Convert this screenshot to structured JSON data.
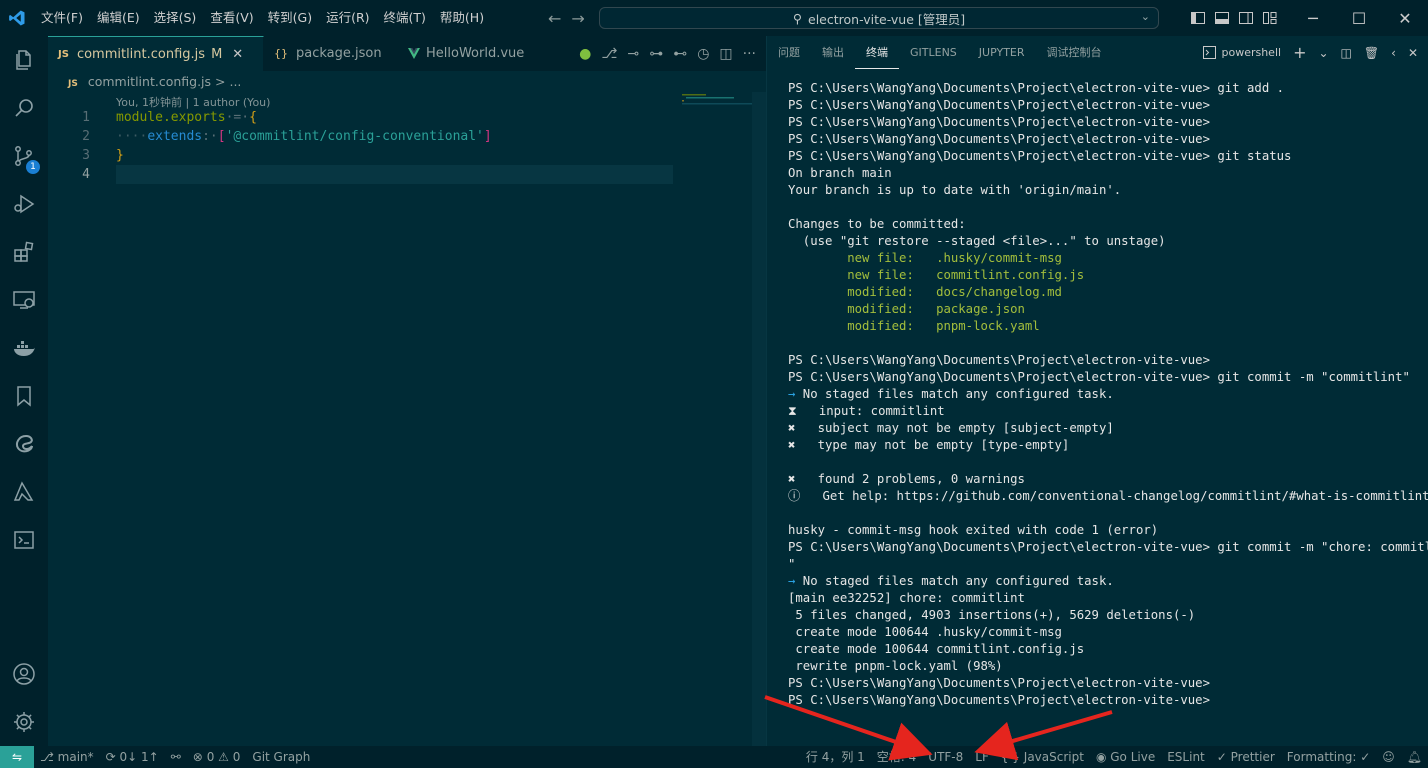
{
  "window": {
    "title": "electron-vite-vue [管理员]",
    "menu": [
      "文件(F)",
      "编辑(E)",
      "选择(S)",
      "查看(V)",
      "转到(G)",
      "运行(R)",
      "终端(T)",
      "帮助(H)"
    ]
  },
  "activity_bar": {
    "icons": [
      "explorer-icon",
      "search-icon",
      "source-control-icon",
      "run-debug-icon",
      "extensions-icon",
      "remote-explorer-icon",
      "docker-icon",
      "bookmarks-icon",
      "edge-icon",
      "testing-icon",
      "terminal-icon",
      "account-icon",
      "settings-gear-icon"
    ],
    "scm_badge": "1"
  },
  "editor": {
    "tabs": [
      {
        "label": "commitlint.config.js",
        "kind": "JS",
        "modified": "M",
        "active": true
      },
      {
        "label": "package.json",
        "kind": "{}"
      },
      {
        "label": "HelloWorld.vue",
        "kind": "vue"
      }
    ],
    "breadcrumb": {
      "file": "commitlint.config.js",
      "sep": ">",
      "rest": "..."
    },
    "breadcrumb_js": "JS",
    "codelens": "You, 1秒钟前 | 1 author (You)",
    "lines": [
      {
        "num": "1"
      },
      {
        "num": "2"
      },
      {
        "num": "3"
      },
      {
        "num": "4"
      }
    ],
    "code": {
      "l1_a": "module.exports",
      "l1_b": "·=·",
      "l1_c": "{",
      "l2_indent": "····",
      "l2_key": "extends",
      "l2_colon": ":·",
      "l2_open": "[",
      "l2_str": "'@commitlint/config-conventional'",
      "l2_close": "]",
      "l3": "}"
    }
  },
  "panel": {
    "tabs": [
      "问题",
      "输出",
      "终端",
      "GITLENS",
      "JUPYTER",
      "调试控制台"
    ],
    "active_tab": "终端",
    "shell": "powershell",
    "terminal_lines": [
      {
        "t": "PS C:\\Users\\WangYang\\Documents\\Project\\electron-vite-vue> git add ."
      },
      {
        "t": "PS C:\\Users\\WangYang\\Documents\\Project\\electron-vite-vue>"
      },
      {
        "t": "PS C:\\Users\\WangYang\\Documents\\Project\\electron-vite-vue>"
      },
      {
        "t": "PS C:\\Users\\WangYang\\Documents\\Project\\electron-vite-vue>"
      },
      {
        "t": "PS C:\\Users\\WangYang\\Documents\\Project\\electron-vite-vue> git status"
      },
      {
        "t": "On branch main"
      },
      {
        "t": "Your branch is up to date with 'origin/main'."
      },
      {
        "t": ""
      },
      {
        "t": "Changes to be committed:"
      },
      {
        "t": "  (use \"git restore --staged <file>...\" to unstage)"
      },
      {
        "t": "        new file:   .husky/commit-msg",
        "c": "ok"
      },
      {
        "t": "        new file:   commitlint.config.js",
        "c": "ok"
      },
      {
        "t": "        modified:   docs/changelog.md",
        "c": "ok"
      },
      {
        "t": "        modified:   package.json",
        "c": "ok"
      },
      {
        "t": "        modified:   pnpm-lock.yaml",
        "c": "ok"
      },
      {
        "t": ""
      },
      {
        "t": "PS C:\\Users\\WangYang\\Documents\\Project\\electron-vite-vue>"
      },
      {
        "t": "PS C:\\Users\\WangYang\\Documents\\Project\\electron-vite-vue> git commit -m \"commitlint\""
      },
      {
        "t": " No staged files match any configured task.",
        "arrow": "→"
      },
      {
        "t": "⧗   input: commitlint"
      },
      {
        "t": "✖   subject may not be empty [subject-empty]"
      },
      {
        "t": "✖   type may not be empty [type-empty]"
      },
      {
        "t": ""
      },
      {
        "t": "✖   found 2 problems, 0 warnings"
      },
      {
        "t": "ⓘ   Get help: https://github.com/conventional-changelog/commitlint/#what-is-commitlint"
      },
      {
        "t": ""
      },
      {
        "t": "husky - commit-msg hook exited with code 1 (error)"
      },
      {
        "t": "PS C:\\Users\\WangYang\\Documents\\Project\\electron-vite-vue> git commit -m \"chore: commitlint"
      },
      {
        "t": "\""
      },
      {
        "t": " No staged files match any configured task.",
        "arrow": "→"
      },
      {
        "t": "[main ee32252] chore: commitlint"
      },
      {
        "t": " 5 files changed, 4903 insertions(+), 5629 deletions(-)"
      },
      {
        "t": " create mode 100644 .husky/commit-msg"
      },
      {
        "t": " create mode 100644 commitlint.config.js"
      },
      {
        "t": " rewrite pnpm-lock.yaml (98%)"
      },
      {
        "t": "PS C:\\Users\\WangYang\\Documents\\Project\\electron-vite-vue>"
      },
      {
        "t": "PS C:\\Users\\WangYang\\Documents\\Project\\electron-vite-vue>"
      }
    ]
  },
  "statusbar": {
    "branch": "main*",
    "sync": "0↓ 1↑",
    "problems": "0",
    "warnings": "0",
    "git_graph": "Git Graph",
    "position": "行 4，列 1",
    "spaces": "空格: 4",
    "encoding": "UTF-8",
    "eol": "LF",
    "language": "JavaScript",
    "language_braces": "{ }",
    "go_live": "Go Live",
    "eslint": "ESLint",
    "prettier": "Prettier",
    "formatting": "Formatting: ✓"
  },
  "colors": {
    "arrow": "#e5251e",
    "accent": "#2aa198"
  }
}
